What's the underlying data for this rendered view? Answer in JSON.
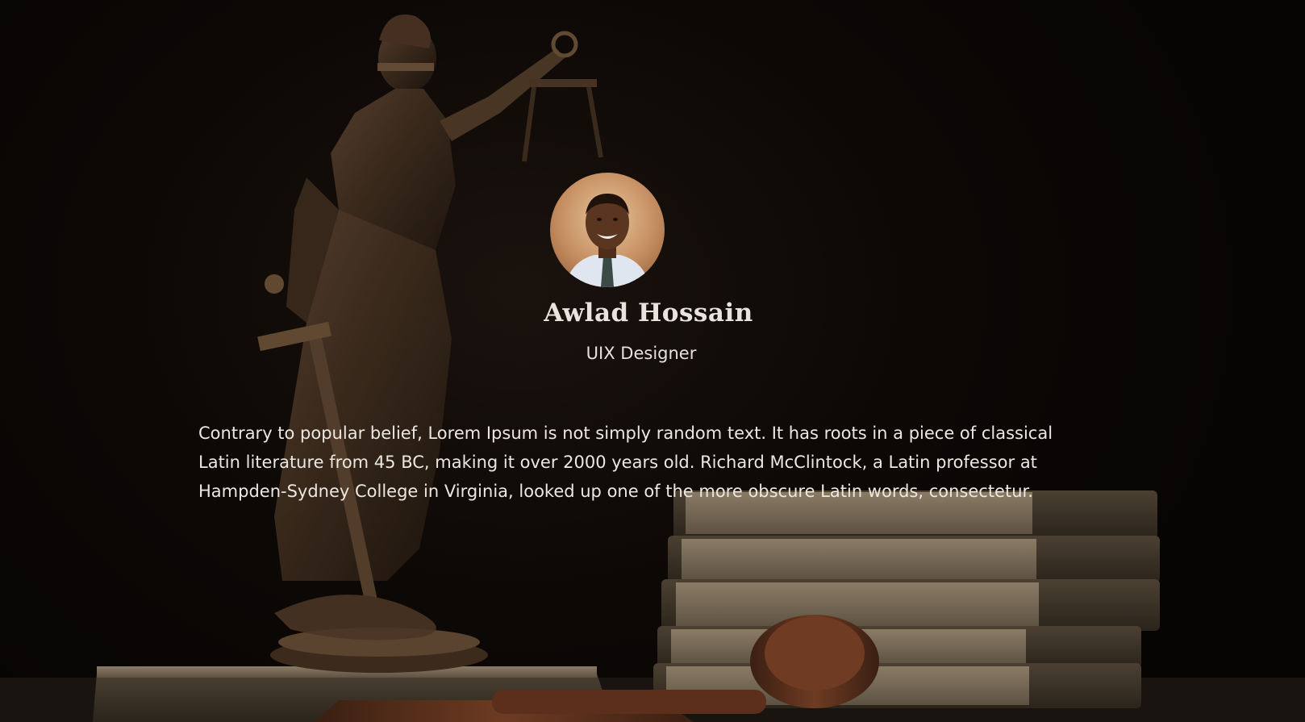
{
  "profile": {
    "name": "Awlad Hossain",
    "role": "UIX Designer",
    "bio": "Contrary to popular belief, Lorem Ipsum is not simply random text. It has roots in a piece of classical Latin literature from 45 BC, making it over 2000 years old. Richard McClintock, a Latin professor at Hampden-Sydney College in Virginia, looked up one of the more obscure Latin words, consectetur."
  },
  "colors": {
    "background": "#0a0706",
    "text": "#ece7e0",
    "bronze": "#4a3522",
    "book_page": "#7d705c"
  }
}
